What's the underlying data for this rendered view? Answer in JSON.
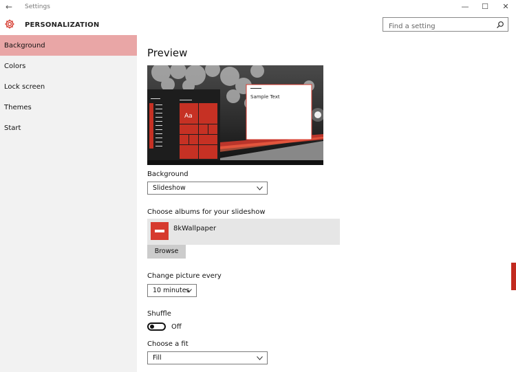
{
  "window": {
    "title": "Settings",
    "back_glyph": "←",
    "minimize_glyph": "—",
    "maximize_glyph": "☐",
    "close_glyph": "✕"
  },
  "header": {
    "title": "PERSONALIZATION",
    "icon": "gear-icon"
  },
  "search": {
    "placeholder": "Find a setting",
    "icon": "search-icon"
  },
  "sidebar": {
    "items": [
      {
        "label": "Background",
        "active": true
      },
      {
        "label": "Colors"
      },
      {
        "label": "Lock screen"
      },
      {
        "label": "Themes"
      },
      {
        "label": "Start"
      }
    ]
  },
  "main": {
    "preview_title": "Preview",
    "preview": {
      "tile_text": "Aa",
      "window_text": "Sample Text"
    },
    "background": {
      "label": "Background",
      "value": "Slideshow"
    },
    "albums": {
      "label": "Choose albums for your slideshow",
      "items": [
        {
          "name": "8kWallpaper"
        }
      ],
      "browse_label": "Browse"
    },
    "change_picture": {
      "label": "Change picture every",
      "value": "10 minutes"
    },
    "shuffle": {
      "label": "Shuffle",
      "state": "Off"
    },
    "fit": {
      "label": "Choose a fit",
      "value": "Fill"
    }
  },
  "colors": {
    "accent": "#d63a2e",
    "sidebar_active": "#e9a6a6",
    "sidebar_bg": "#f2f2f2"
  }
}
